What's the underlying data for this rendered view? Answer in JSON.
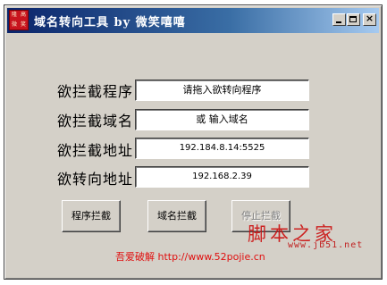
{
  "window": {
    "title": "域名转向工具  by 微笑嘻嘻",
    "app_icon_glyphs": [
      "隆",
      "高",
      "微",
      "笑"
    ]
  },
  "form": {
    "fields": [
      {
        "label": "欲拦截程序",
        "value": "请拖入欲转向程序"
      },
      {
        "label": "欲拦截域名",
        "value": "或 输入域名"
      },
      {
        "label": "欲拦截地址",
        "value": "192.184.8.14:5525"
      },
      {
        "label": "欲转向地址",
        "value": "192.168.2.39"
      }
    ]
  },
  "buttons": {
    "program_intercept": "程序拦截",
    "domain_intercept": "域名拦截",
    "stop_intercept": "停止拦截"
  },
  "footer": {
    "text": "吾爱破解  http://www.52pojie.cn"
  },
  "watermark": {
    "text": "脚本之家",
    "url": "www.jb51.net"
  },
  "colors": {
    "titlebar_start": "#0a246a",
    "titlebar_end": "#a6caf0",
    "face": "#d4d0c8",
    "footer_red": "#e01010"
  }
}
